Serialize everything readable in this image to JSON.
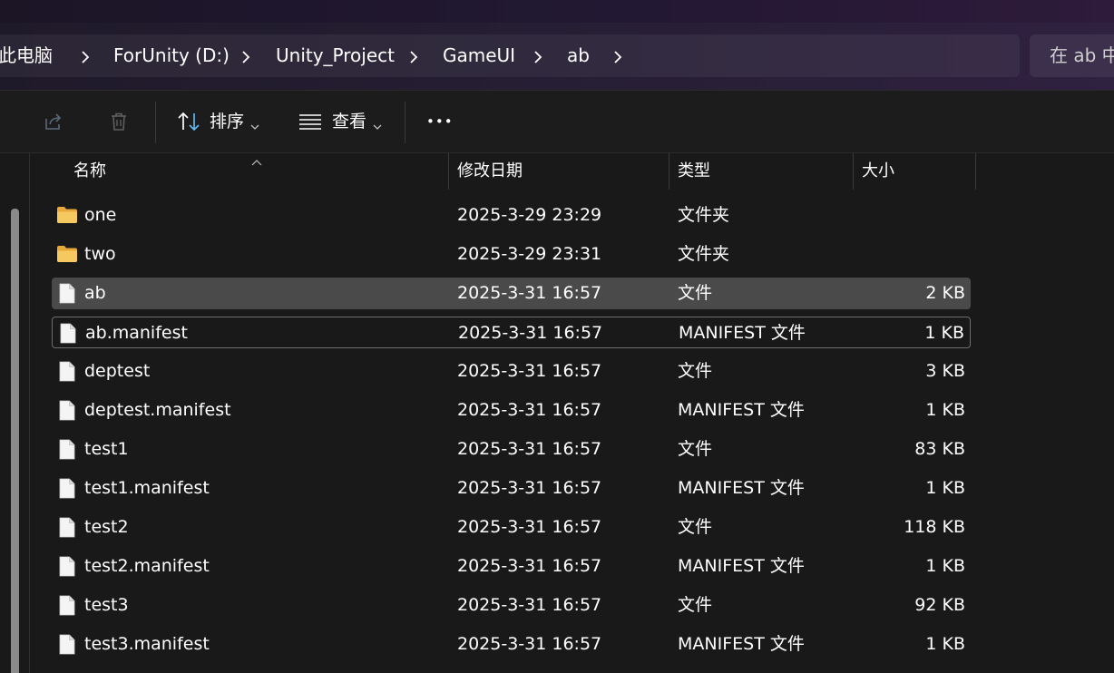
{
  "breadcrumb": {
    "items": [
      "此电脑",
      "ForUnity (D:)",
      "Unity_Project",
      "GameUI",
      "ab"
    ]
  },
  "search": {
    "placeholder": "在 ab 中"
  },
  "toolbar": {
    "sort_label": "排序",
    "view_label": "查看",
    "more_label": "•••"
  },
  "columns": {
    "name": "名称",
    "date": "修改日期",
    "type": "类型",
    "size": "大小"
  },
  "files": [
    {
      "name": "one",
      "date": "2025-3-29 23:29",
      "type": "文件夹",
      "size": "",
      "icon": "folder-icon"
    },
    {
      "name": "two",
      "date": "2025-3-29 23:31",
      "type": "文件夹",
      "size": "",
      "icon": "folder-icon"
    },
    {
      "name": "ab",
      "date": "2025-3-31 16:57",
      "type": "文件",
      "size": "2 KB",
      "icon": "file-icon",
      "state": "selected"
    },
    {
      "name": "ab.manifest",
      "date": "2025-3-31 16:57",
      "type": "MANIFEST 文件",
      "size": "1 KB",
      "icon": "file-icon",
      "state": "focused"
    },
    {
      "name": "deptest",
      "date": "2025-3-31 16:57",
      "type": "文件",
      "size": "3 KB",
      "icon": "file-icon"
    },
    {
      "name": "deptest.manifest",
      "date": "2025-3-31 16:57",
      "type": "MANIFEST 文件",
      "size": "1 KB",
      "icon": "file-icon"
    },
    {
      "name": "test1",
      "date": "2025-3-31 16:57",
      "type": "文件",
      "size": "83 KB",
      "icon": "file-icon"
    },
    {
      "name": "test1.manifest",
      "date": "2025-3-31 16:57",
      "type": "MANIFEST 文件",
      "size": "1 KB",
      "icon": "file-icon"
    },
    {
      "name": "test2",
      "date": "2025-3-31 16:57",
      "type": "文件",
      "size": "118 KB",
      "icon": "file-icon"
    },
    {
      "name": "test2.manifest",
      "date": "2025-3-31 16:57",
      "type": "MANIFEST 文件",
      "size": "1 KB",
      "icon": "file-icon"
    },
    {
      "name": "test3",
      "date": "2025-3-31 16:57",
      "type": "文件",
      "size": "92 KB",
      "icon": "file-icon"
    },
    {
      "name": "test3.manifest",
      "date": "2025-3-31 16:57",
      "type": "MANIFEST 文件",
      "size": "1 KB",
      "icon": "file-icon"
    }
  ],
  "colors": {
    "background": "#191919",
    "selected_row": "#4a4a4a",
    "folder": "#f2c14e",
    "accent": "#2f2140"
  }
}
